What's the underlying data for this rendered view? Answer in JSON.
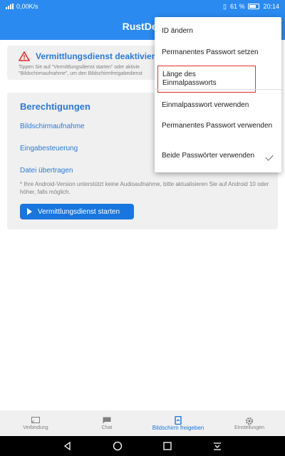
{
  "status": {
    "speed": "0,00K/s",
    "battery": "61 %",
    "time": "20:14"
  },
  "appbar": {
    "title": "RustDes"
  },
  "service_card": {
    "title": "Vermittlungsdienst deaktiviert",
    "hint_line1": "Tippen Sie auf \"Vermittlungsdienst starten\" oder aktivie",
    "hint_line2": "\"Bildschirmaufnahme\", um den Bildschirmfreigabedienst"
  },
  "permissions_card": {
    "title": "Berechtigungen",
    "items": [
      "Bildschirmaufnahme",
      "Eingabesteuerung",
      "Datei übertragen"
    ],
    "note": "* Ihre Android-Version unterstützt keine Audioaufnahme, bitte aktualisieren Sie auf Android 10 oder höher, falls möglich.",
    "start_button": "Vermittlungsdienst starten"
  },
  "menu": {
    "items": [
      "ID ändern",
      "Permanentes Passwort setzen",
      "Länge des Einmalpassworts",
      "Einmalpasswort verwenden",
      "Permanentes Passwort verwenden",
      "Beide Passwörter verwenden"
    ]
  },
  "bottom_nav": {
    "tabs": [
      "Verbindung",
      "Chat",
      "Bildschirm freigeben",
      "Einstellungen"
    ],
    "active": "Bildschirm freigeben"
  },
  "colors": {
    "primary": "#2a8af0",
    "accent_text": "#2a7ad8",
    "button": "#1976e0",
    "highlight_border": "#e03030",
    "warning": "#e03030"
  }
}
